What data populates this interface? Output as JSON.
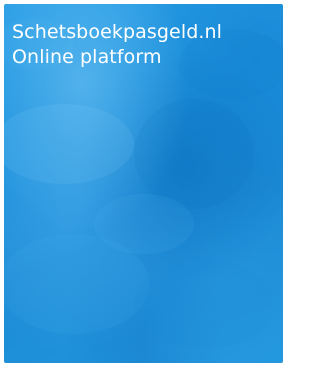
{
  "card": {
    "title": "Schetsboekpasgeld.nl",
    "subtitle": "Online platform",
    "background_color": "#1f93de",
    "text_color": "#ffffff"
  }
}
